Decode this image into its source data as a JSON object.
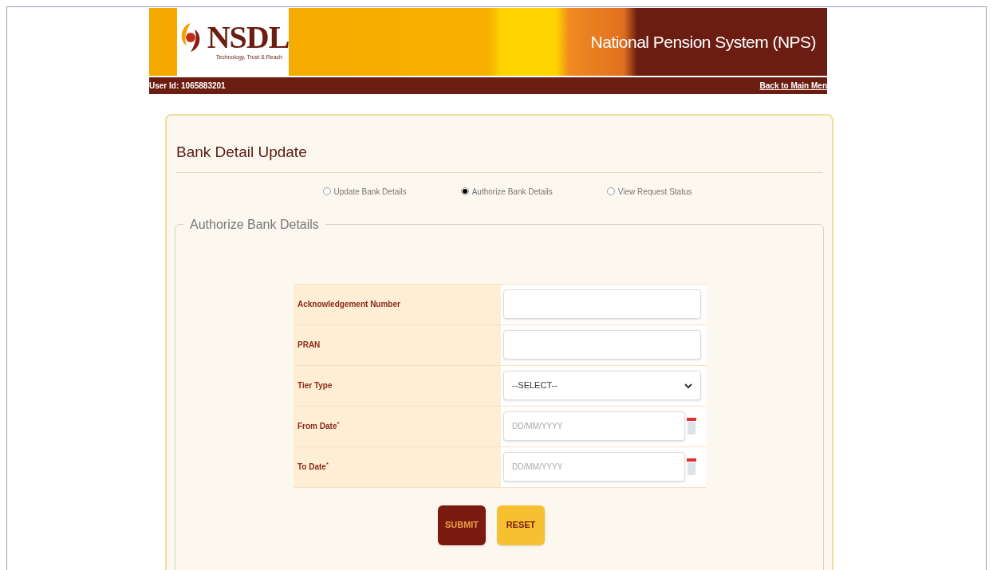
{
  "header": {
    "logo_text": "NSDL",
    "tagline": "Technology, Trust & Reach",
    "title": "National Pension System (NPS)",
    "user_id": "User Id: 1065883201",
    "back_link": "Back to Main Men"
  },
  "page_title": "Bank Detail Update",
  "options": [
    {
      "label": "Update Bank Details",
      "selected": false
    },
    {
      "label": "Authorize Bank Details",
      "selected": true
    },
    {
      "label": "View Request Status",
      "selected": false
    }
  ],
  "section_title": "Authorize Bank Details",
  "fields": [
    {
      "kind": "text",
      "label": "Acknowledgement Number"
    },
    {
      "kind": "text",
      "label": "PRAN"
    },
    {
      "kind": "select",
      "label": "Tier Type",
      "value": "--SELECT--"
    },
    {
      "kind": "date",
      "label": "From Date",
      "required_mark": "*",
      "placeholder": "DD/MM/YYYY"
    },
    {
      "kind": "date",
      "label": "To Date",
      "required_mark": "*",
      "placeholder": "DD/MM/YYYY"
    }
  ],
  "buttons": [
    {
      "kind": "submit",
      "label": "SUBMIT"
    },
    {
      "kind": "reset",
      "label": "RESET"
    }
  ]
}
